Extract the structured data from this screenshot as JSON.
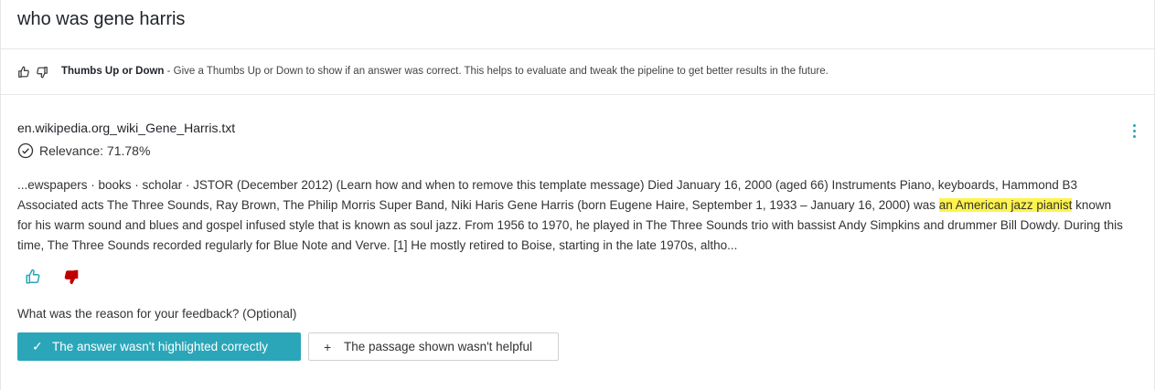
{
  "query": "who was gene harris",
  "hint": {
    "title": "Thumbs Up or Down",
    "text": " - Give a Thumbs Up or Down to show if an answer was correct. This helps to evaluate and tweak the pipeline to get better results in the future."
  },
  "result": {
    "doc_title": "en.wikipedia.org_wiki_Gene_Harris.txt",
    "relevance": "Relevance: 71.78%",
    "passage_before": "...ewspapers · books · scholar · JSTOR (December 2012) (Learn how and when to remove this template message) Died January 16, 2000 (aged 66) Instruments Piano, keyboards, Hammond B3 Associated acts The Three Sounds, Ray Brown, The Philip Morris Super Band, Niki Haris Gene Harris (born Eugene Haire, September 1, 1933 – January 16, 2000) was ",
    "passage_highlight": "an American jazz pianist",
    "passage_after": " known for his warm sound and blues and gospel infused style that is known as soul jazz. From 1956 to 1970, he played in The Three Sounds trio with bassist Andy Simpkins and drummer Bill Dowdy. During this time, The Three Sounds recorded regularly for Blue Note and Verve. [1] He mostly retired to Boise, starting in the late 1970s, altho..."
  },
  "feedback": {
    "reason_label": "What was the reason for your feedback? (Optional)",
    "option_selected": "The answer wasn't highlighted correctly",
    "option_other": "The passage shown wasn't helpful",
    "selected_glyph": "✓",
    "other_glyph": "+"
  },
  "colors": {
    "accent": "#2ba6b9",
    "thumbs_down_active": "#c00000",
    "highlight": "#fff34d"
  },
  "icons": {
    "hint_up": "thumbs-up-icon",
    "hint_down": "thumbs-down-icon",
    "relevance": "check-circle-icon",
    "menu": "kebab-menu-icon"
  }
}
